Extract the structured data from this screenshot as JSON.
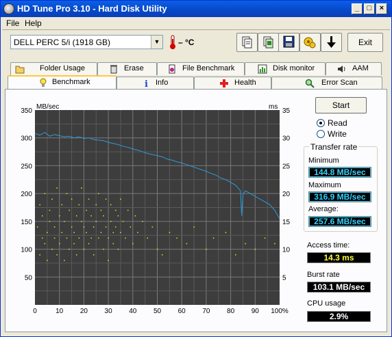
{
  "window": {
    "title": "HD Tune Pro 3.10 - Hard Disk Utility",
    "controls": {
      "minimize": "_",
      "maximize": "□",
      "close": "×"
    }
  },
  "menu": [
    "File",
    "Help"
  ],
  "drive_select": {
    "value": "DELL    PERC 5/i (1918 GB)"
  },
  "temperature": {
    "value": "– °C"
  },
  "toolbar": {
    "buttons": [
      "copy-info-icon",
      "copy-screenshot-icon",
      "save-icon",
      "options-icon",
      "download-icon"
    ],
    "exit_label": "Exit"
  },
  "tabs_top": [
    {
      "label": "Folder Usage",
      "icon": "folder-icon"
    },
    {
      "label": "Erase",
      "icon": "trash-icon"
    },
    {
      "label": "File Benchmark",
      "icon": "file-benchmark-icon"
    },
    {
      "label": "Disk monitor",
      "icon": "disk-monitor-icon"
    },
    {
      "label": "AAM",
      "icon": "speaker-icon"
    }
  ],
  "tabs_bottom": [
    {
      "label": "Benchmark",
      "icon": "lightbulb-icon",
      "active": true
    },
    {
      "label": "Info",
      "icon": "info-icon"
    },
    {
      "label": "Health",
      "icon": "health-cross-icon"
    },
    {
      "label": "Error Scan",
      "icon": "magnifier-icon"
    }
  ],
  "controls": {
    "start_label": "Start",
    "mode_options": [
      {
        "label": "Read",
        "selected": true
      },
      {
        "label": "Write",
        "selected": false
      }
    ]
  },
  "transfer_rate": {
    "title": "Transfer rate",
    "minimum_label": "Minimum",
    "minimum_value": "144.8 MB/sec",
    "maximum_label": "Maximum",
    "maximum_value": "316.9 MB/sec",
    "average_label": "Average:",
    "average_value": "257.6 MB/sec"
  },
  "access_time": {
    "label": "Access time:",
    "value": "14.3 ms"
  },
  "burst_rate": {
    "label": "Burst rate",
    "value": "103.1 MB/sec"
  },
  "cpu_usage": {
    "label": "CPU usage",
    "value": "2.9%"
  },
  "colors": {
    "transfer_line": "#2f9bdc",
    "access_points": "#e6e61e",
    "plot_bg": "#3d3d3d",
    "grid": "#6a6a6a"
  },
  "chart_data": {
    "type": "line",
    "left_axis_label": "MB/sec",
    "right_axis_label": "ms",
    "ylim_left": [
      0,
      350
    ],
    "ylim_right": [
      0,
      35
    ],
    "left_ticks": [
      "350",
      "300",
      "250",
      "200",
      "150",
      "100",
      "50"
    ],
    "right_ticks": [
      "35",
      "30",
      "25",
      "20",
      "15",
      "10",
      "5"
    ],
    "x_ticks": [
      "0",
      "10",
      "20",
      "30",
      "40",
      "50",
      "60",
      "70",
      "80",
      "90",
      "100%"
    ],
    "series": [
      {
        "kind": "transfer_rate",
        "x": [
          0,
          2,
          4,
          6,
          8,
          10,
          12,
          14,
          16,
          18,
          20,
          22,
          24,
          26,
          28,
          30,
          32,
          34,
          36,
          38,
          40,
          42,
          44,
          46,
          48,
          50,
          52,
          54,
          56,
          58,
          60,
          62,
          64,
          66,
          68,
          70,
          72,
          74,
          76,
          78,
          80,
          82,
          84,
          84.5,
          85,
          86,
          88,
          90,
          92,
          94,
          96,
          98,
          100
        ],
        "y": [
          308,
          305,
          310,
          303,
          306,
          304,
          302,
          303,
          300,
          302,
          299,
          300,
          297,
          296,
          295,
          292,
          290,
          288,
          285,
          283,
          280,
          278,
          275,
          272,
          270,
          268,
          266,
          262,
          260,
          257,
          255,
          252,
          249,
          246,
          243,
          240,
          236,
          233,
          228,
          225,
          220,
          215,
          205,
          160,
          198,
          205,
          200,
          195,
          190,
          185,
          180,
          170,
          155
        ]
      },
      {
        "kind": "access_time_ms",
        "points": [
          [
            1,
            14
          ],
          [
            2,
            18
          ],
          [
            2,
            9
          ],
          [
            3,
            12
          ],
          [
            3,
            16
          ],
          [
            4,
            11
          ],
          [
            4,
            20
          ],
          [
            5,
            13
          ],
          [
            5,
            8
          ],
          [
            6,
            17
          ],
          [
            6,
            15
          ],
          [
            7,
            10
          ],
          [
            7,
            19
          ],
          [
            8,
            12
          ],
          [
            8,
            14
          ],
          [
            9,
            21
          ],
          [
            9,
            9
          ],
          [
            10,
            16
          ],
          [
            10,
            11
          ],
          [
            11,
            13
          ],
          [
            11,
            18
          ],
          [
            12,
            15
          ],
          [
            12,
            8
          ],
          [
            13,
            20
          ],
          [
            13,
            12
          ],
          [
            14,
            10
          ],
          [
            14,
            17
          ],
          [
            15,
            14
          ],
          [
            15,
            19
          ],
          [
            16,
            11
          ],
          [
            16,
            13
          ],
          [
            17,
            16
          ],
          [
            17,
            9
          ],
          [
            18,
            18
          ],
          [
            18,
            12
          ],
          [
            19,
            15
          ],
          [
            19,
            21
          ],
          [
            20,
            10
          ],
          [
            20,
            14
          ],
          [
            21,
            17
          ],
          [
            21,
            13
          ],
          [
            22,
            11
          ],
          [
            22,
            19
          ],
          [
            23,
            16
          ],
          [
            23,
            12
          ],
          [
            24,
            14
          ],
          [
            24,
            9
          ],
          [
            25,
            18
          ],
          [
            25,
            15
          ],
          [
            26,
            12
          ],
          [
            26,
            20
          ],
          [
            27,
            13
          ],
          [
            27,
            17
          ],
          [
            28,
            10
          ],
          [
            28,
            16
          ],
          [
            29,
            14
          ],
          [
            29,
            19
          ],
          [
            30,
            12
          ],
          [
            30,
            8
          ],
          [
            31,
            15
          ],
          [
            31,
            18
          ],
          [
            32,
            13
          ],
          [
            32,
            11
          ],
          [
            33,
            17
          ],
          [
            33,
            14
          ],
          [
            34,
            16
          ],
          [
            34,
            10
          ],
          [
            35,
            13
          ],
          [
            35,
            19
          ],
          [
            36,
            15
          ],
          [
            37,
            12
          ],
          [
            38,
            17
          ],
          [
            39,
            14
          ],
          [
            40,
            11
          ],
          [
            41,
            16
          ],
          [
            42,
            13
          ],
          [
            44,
            15
          ],
          [
            46,
            12
          ],
          [
            48,
            14
          ],
          [
            50,
            10
          ],
          [
            52,
            9
          ],
          [
            55,
            13
          ],
          [
            58,
            12
          ],
          [
            62,
            11
          ],
          [
            65,
            14
          ],
          [
            70,
            10
          ],
          [
            73,
            12
          ],
          [
            78,
            13
          ],
          [
            82,
            9
          ],
          [
            86,
            11
          ],
          [
            90,
            10
          ],
          [
            94,
            12
          ],
          [
            98,
            11
          ]
        ]
      }
    ]
  }
}
